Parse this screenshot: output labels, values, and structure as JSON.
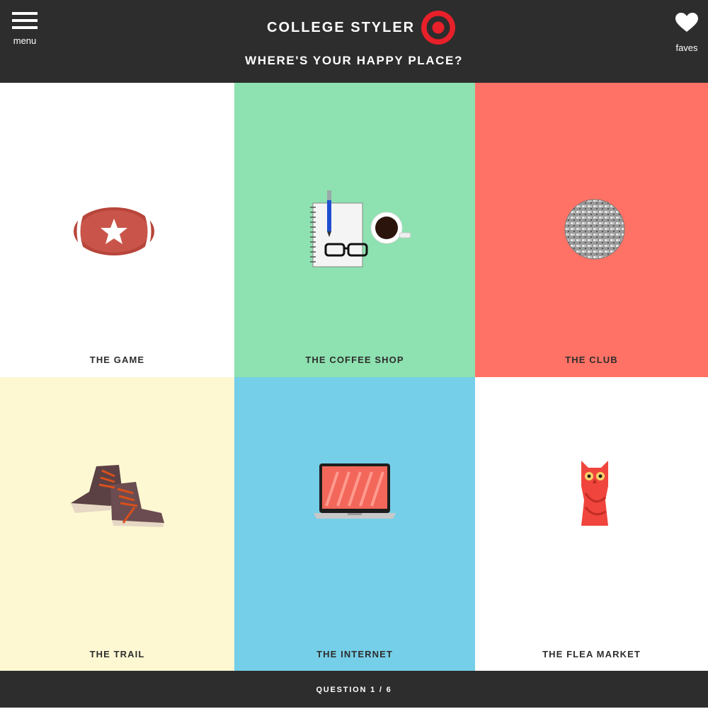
{
  "header": {
    "menu_label": "menu",
    "brand": "COLLEGE STYLER",
    "question": "WHERE'S YOUR HAPPY PLACE?",
    "faves_label": "faves"
  },
  "colors": {
    "bar_bg": "#2d2d2d",
    "accent": "#e8202a",
    "white": "#ffffff",
    "mint": "#8ee1b0",
    "coral": "#ff7265",
    "cream": "#fdf8d2",
    "sky": "#76cfe8"
  },
  "tiles": [
    {
      "label": "THE GAME",
      "icon": "football-icon",
      "bg": "#ffffff"
    },
    {
      "label": "THE COFFEE SHOP",
      "icon": "notebook-coffee-icon",
      "bg": "#8ee1b0"
    },
    {
      "label": "THE CLUB",
      "icon": "disco-ball-icon",
      "bg": "#ff7265"
    },
    {
      "label": "THE TRAIL",
      "icon": "boots-icon",
      "bg": "#fdf8d2"
    },
    {
      "label": "THE INTERNET",
      "icon": "laptop-icon",
      "bg": "#76cfe8"
    },
    {
      "label": "THE FLEA MARKET",
      "icon": "owl-figurine-icon",
      "bg": "#ffffff"
    }
  ],
  "footer": {
    "progress": "QUESTION 1 / 6"
  }
}
